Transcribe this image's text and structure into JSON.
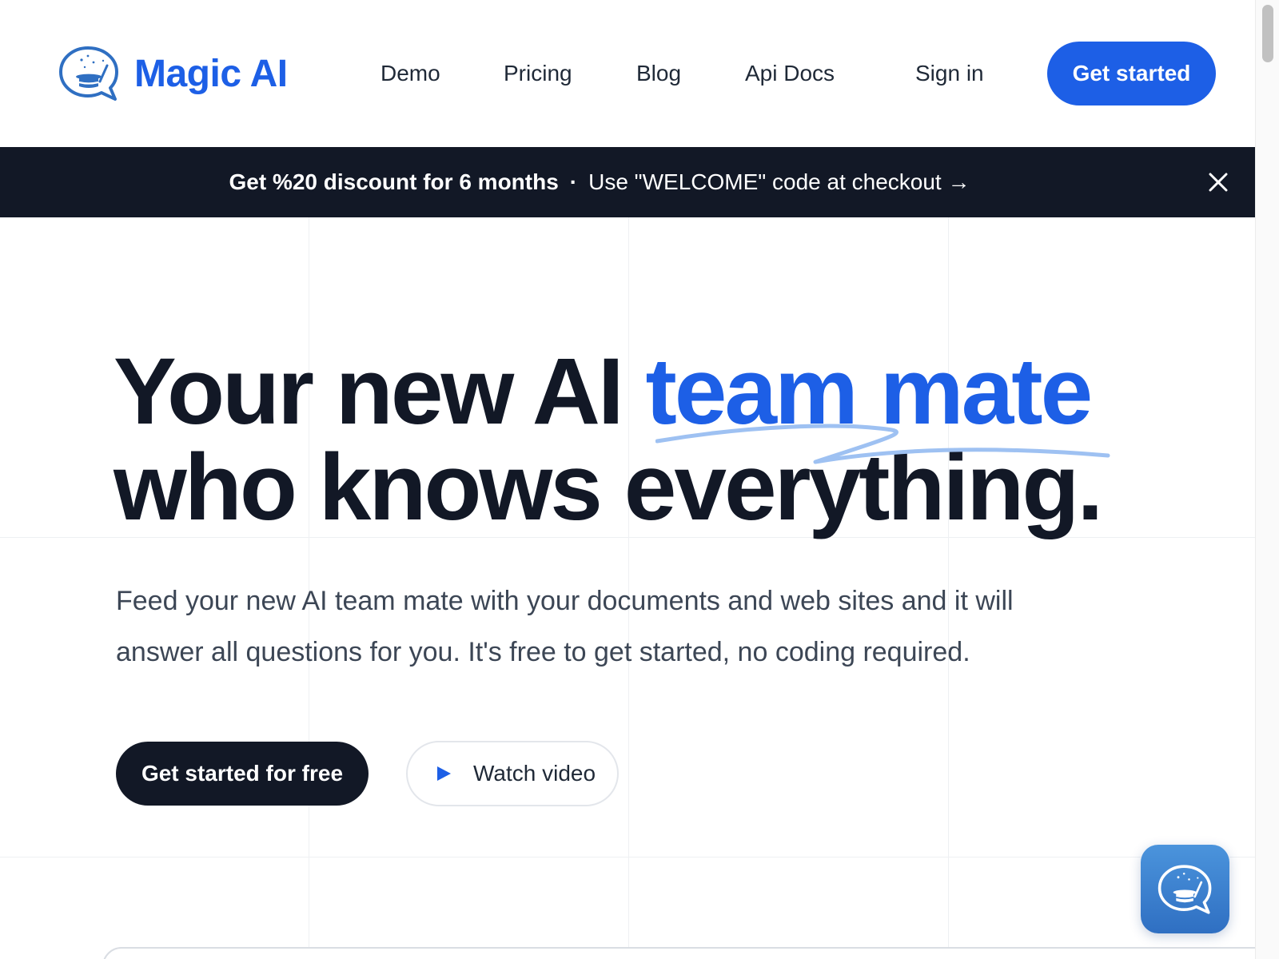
{
  "brand": {
    "name": "Magic AI",
    "color": "#1d5fe6"
  },
  "nav": {
    "links": [
      "Demo",
      "Pricing",
      "Blog",
      "Api Docs"
    ],
    "sign_in": "Sign in",
    "cta": "Get started"
  },
  "banner": {
    "strong_text": "Get %20 discount for 6 months",
    "separator": "·",
    "text": "Use \"WELCOME\" code at checkout →",
    "background": "#121826"
  },
  "hero": {
    "title_part1": "Your new AI ",
    "title_accent": "team mate",
    "title_line2": "who knows everything.",
    "subtitle": "Feed your new AI team mate with your documents and web sites and it will answer all questions for you. It's free to get started, no coding required.",
    "primary_button": "Get started for free",
    "secondary_button": "Watch video"
  },
  "icons": {
    "logo": "magic-hat-chat-bubble",
    "close": "close-icon",
    "play": "play-icon",
    "chat_widget": "magic-hat-chat-bubble"
  }
}
